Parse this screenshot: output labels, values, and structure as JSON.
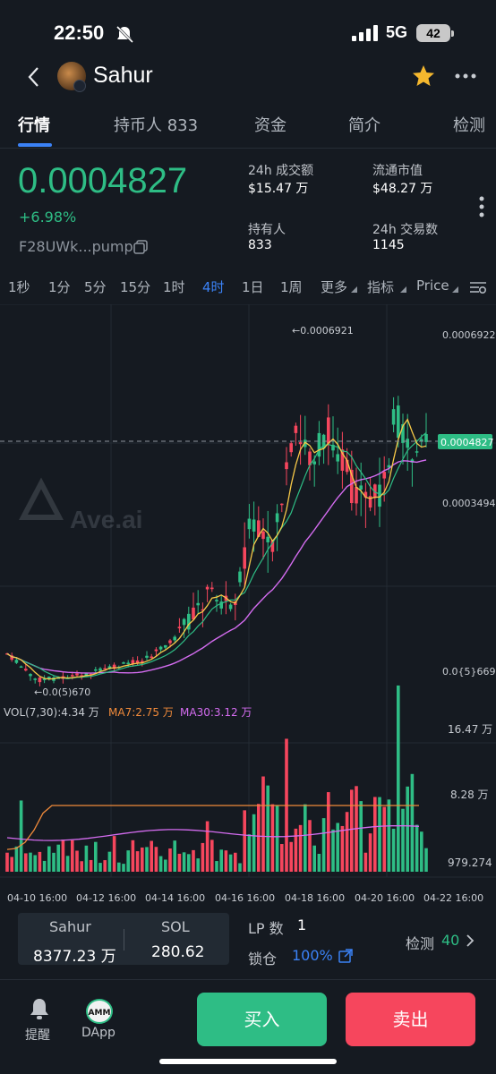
{
  "status": {
    "time": "22:50",
    "network": "5G",
    "battery": "42"
  },
  "header": {
    "title": "Sahur"
  },
  "tabs": [
    "行情",
    "持币人 833",
    "资金",
    "简介",
    "检测"
  ],
  "price": {
    "value": "0.0004827",
    "change": "+6.98%",
    "address": "F28UWk...pump"
  },
  "stats": {
    "vol_label": "24h 成交额",
    "vol_value": "$15.47 万",
    "mcap_label": "流通市值",
    "mcap_value": "$48.27 万",
    "holders_label": "持有人",
    "holders_value": "833",
    "tx_label": "24h 交易数",
    "tx_value": "1145"
  },
  "timeframes": [
    "1秒",
    "1分",
    "5分",
    "15分",
    "1时",
    "4时",
    "1日",
    "1周",
    "更多",
    "指标",
    "Price"
  ],
  "chart": {
    "watermark": "Ave.ai",
    "y_top": "0.0006922",
    "y_mid": "0.0003494",
    "y_low": "0.0{5}669",
    "current": "0.0004827",
    "high_marker": "←0.0006921",
    "low_marker": "←0.0(5)670",
    "vol_legend": "VOL(7,30):4.34 万",
    "ma7_legend": "MA7:2.75 万",
    "ma30_legend": "MA30:3.12 万",
    "vol_top": "16.47 万",
    "vol_mid": "8.28 万",
    "vol_low": "979.274",
    "x_labels": [
      "04-10 16:00",
      "04-12 16:00",
      "04-14 16:00",
      "04-16 16:00",
      "04-18 16:00",
      "04-20 16:00",
      "04-22 16:00"
    ]
  },
  "bottom": {
    "token_label": "Sahur",
    "token_value": "8377.23 万",
    "sol_label": "SOL",
    "sol_value": "280.62",
    "lp_label": "LP 数",
    "lp_value": "1",
    "lock_label": "锁仓",
    "lock_value": "100%",
    "check_label": "检测",
    "check_value": "40",
    "alert_label": "提醒",
    "dapp_label": "DApp",
    "amm_label": "AMM",
    "buy": "买入",
    "sell": "卖出"
  },
  "colors": {
    "up": "#2ebd85",
    "down": "#f6465d",
    "accent": "#3b82f6",
    "ma7": "#f7c948",
    "ma30": "#d46cf0",
    "ma_short": "#2ebd85"
  }
}
